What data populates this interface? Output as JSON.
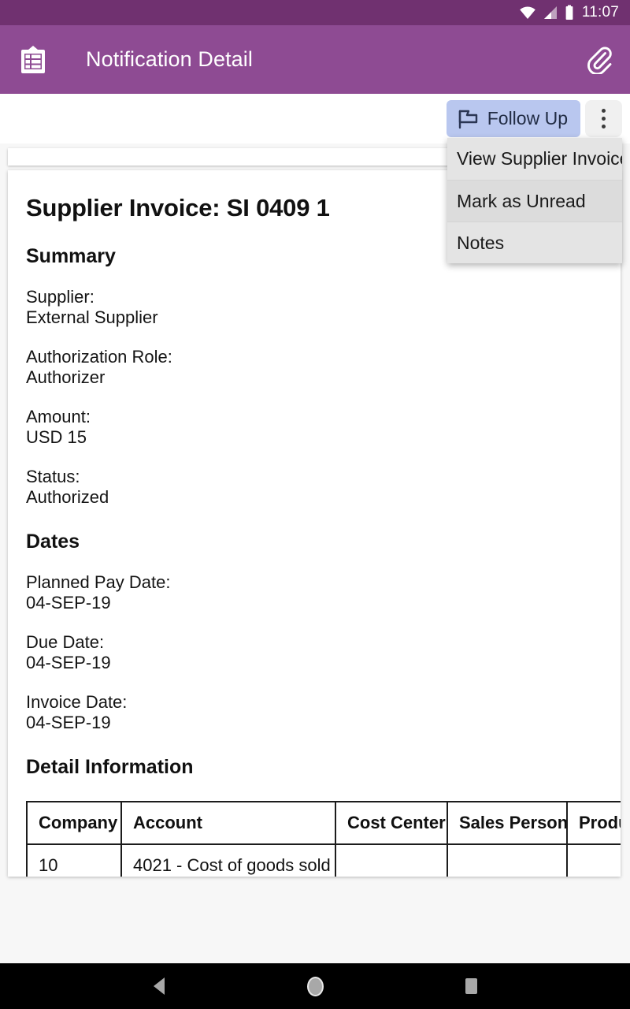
{
  "status_bar": {
    "clock": "11:07",
    "icons": [
      "wifi-icon",
      "cellular-signal-icon",
      "battery-icon"
    ]
  },
  "app_bar": {
    "leading_icon": "clipboard-list-icon",
    "title": "Notification Detail",
    "action_icon": "attachment-paperclip-icon"
  },
  "action_toolbar": {
    "follow_up_label": "Follow Up",
    "follow_up_icon": "flag-icon",
    "follow_up_bg": "#b9c7ef",
    "overflow_icon": "more-vertical-icon"
  },
  "overflow_menu": {
    "open": true,
    "items": [
      {
        "label": "View Supplier Invoice",
        "highlighted": false
      },
      {
        "label": "Mark as Unread",
        "highlighted": true
      },
      {
        "label": "Notes",
        "highlighted": false
      }
    ]
  },
  "detail": {
    "title": "Supplier Invoice: SI 0409 1",
    "summary_heading": "Summary",
    "summary_fields": [
      {
        "label": "Supplier:",
        "value": "External Supplier"
      },
      {
        "label": "Authorization Role:",
        "value": "Authorizer"
      },
      {
        "label": "Amount:",
        "value": "USD 15"
      },
      {
        "label": "Status:",
        "value": "Authorized"
      }
    ],
    "dates_heading": "Dates",
    "date_fields": [
      {
        "label": "Planned Pay Date:",
        "value": "04-SEP-19"
      },
      {
        "label": "Due Date:",
        "value": "04-SEP-19"
      },
      {
        "label": "Invoice Date:",
        "value": "04-SEP-19"
      }
    ],
    "detail_info_heading": "Detail Information",
    "table": {
      "columns": [
        "Company",
        "Account",
        "Cost Center",
        "Sales Person",
        "Product"
      ],
      "rows": [
        [
          "10",
          "4021 - Cost of goods sold",
          "",
          "",
          ""
        ]
      ]
    }
  },
  "nav_bar": {
    "back": "back-icon",
    "home": "home-icon",
    "recents": "recents-icon"
  },
  "colors": {
    "status_bar": "#703170",
    "app_bar": "#8e4b93",
    "accent": "#b9c7ef",
    "page_bg": "#f7f7f7",
    "menu_bg": "#e4e4e4"
  }
}
